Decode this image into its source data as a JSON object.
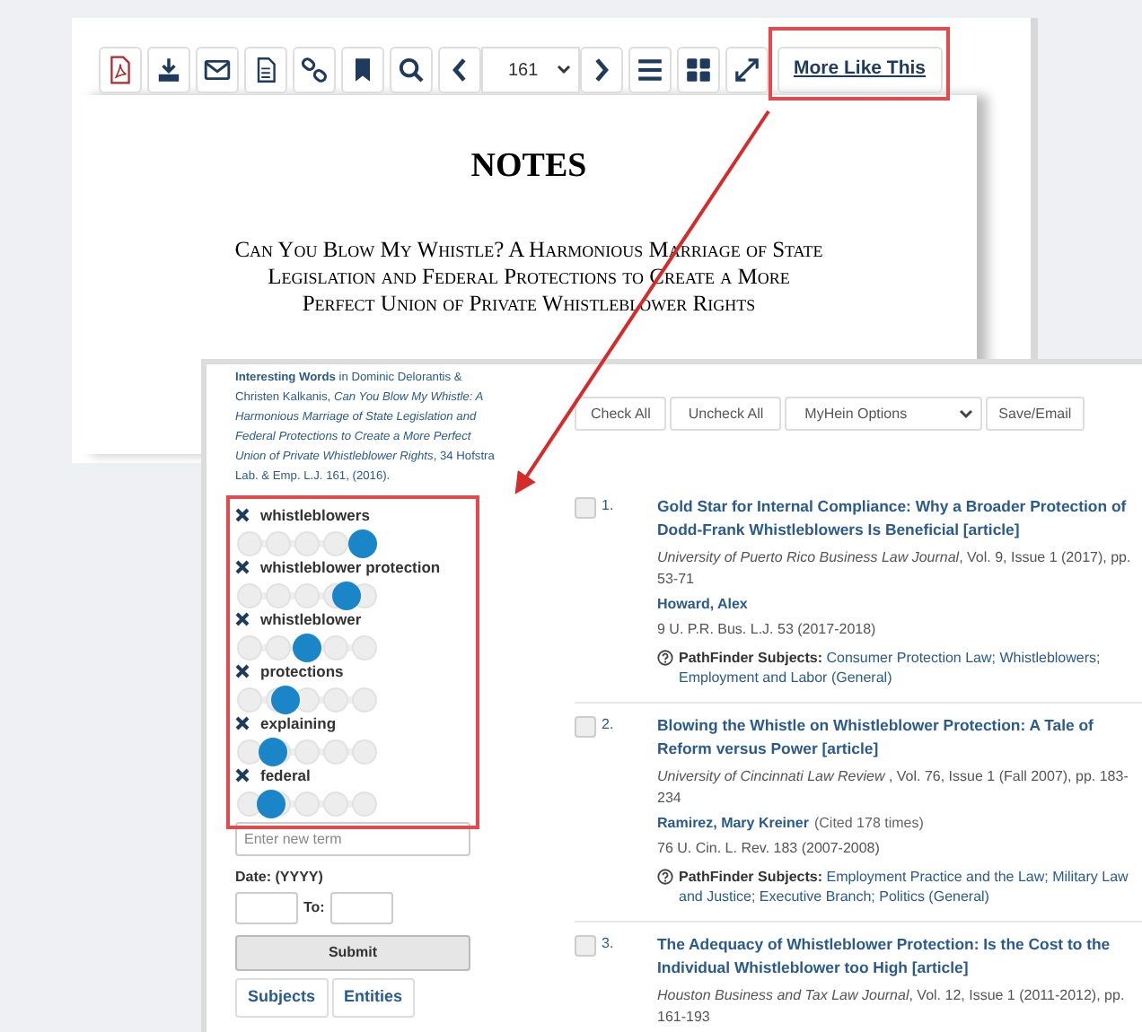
{
  "viewer": {
    "toolbar": {
      "page": "161",
      "more_like_this": "More Like This"
    },
    "document": {
      "heading": "NOTES",
      "title_lines": [
        "Can You Blow My Whistle? A Harmonious Marriage of State",
        "Legislation and Federal Protections to Create a More",
        "Perfect Union of Private Whistleblower Rights"
      ]
    }
  },
  "panel": {
    "citation": "**Interesting Words** in Dominic Delorantis & Christen Kalkanis, *Can You Blow My Whistle: A Harmonious Marriage of State Legislation and Federal Protections to Create a More Perfect Union of Private Whistleblower Rights*, 34 Hofstra Lab. & Emp. L.J. 161, (2016).",
    "terms": [
      {
        "label": "whistleblowers",
        "level": 1
      },
      {
        "label": "whistleblower protection",
        "level": 0.85
      },
      {
        "label": "whistleblower",
        "level": 0.5
      },
      {
        "label": "protections",
        "level": 0.3
      },
      {
        "label": "explaining",
        "level": 0.2
      },
      {
        "label": "federal",
        "level": 0.18
      }
    ],
    "new_term": {
      "placeholder": "Enter new term"
    },
    "date_label": "Date: (YYYY)",
    "to_label": "To:",
    "submit": "Submit",
    "tabs": [
      "Subjects",
      "Entities"
    ],
    "actions": {
      "check_all": "Check All",
      "uncheck_all": "Uncheck All",
      "options": "MyHein Options",
      "save": "Save/Email"
    },
    "results": [
      {
        "number": "1.",
        "checked": false,
        "title": "Gold Star for Internal Compliance: Why a Broader Protection of Dodd-Frank Whistleblowers Is Beneficial [article]",
        "source": "*University of Puerto Rico Business Law Journal*, Vol. 9, Issue 1 (2017), pp. 53-71",
        "author": "Howard, Alex",
        "citation": "9 U. P.R. Bus. L.J. 53 (2017-2018)",
        "subjects_label": "PathFinder Subjects:",
        "subjects": "Consumer Protection Law; Whistleblowers; Employment and Labor (General)"
      },
      {
        "number": "2.",
        "checked": false,
        "title": "Blowing the Whistle on Whistleblower Protection: A Tale of Reform versus Power [article]",
        "source": "*University of Cincinnati Law Review* , Vol. 76, Issue 1 (Fall 2007), pp. 183-234",
        "author": "Ramirez, Mary Kreiner",
        "cited": "(Cited 178 times)",
        "citation": "76 U. Cin. L. Rev. 183 (2007-2008)",
        "subjects_label": "PathFinder Subjects:",
        "subjects": "Employment Practice and the Law; Military Law and Justice; Executive Branch; Politics (General)"
      },
      {
        "number": "3.",
        "checked": false,
        "title": "The Adequacy of Whistleblower Protection: Is the Cost to the Individual Whistleblower too High [article]",
        "source": "*Houston Business and Tax Law Journal*, Vol. 12, Issue 1 (2011-2012), pp. 161-193"
      }
    ]
  }
}
